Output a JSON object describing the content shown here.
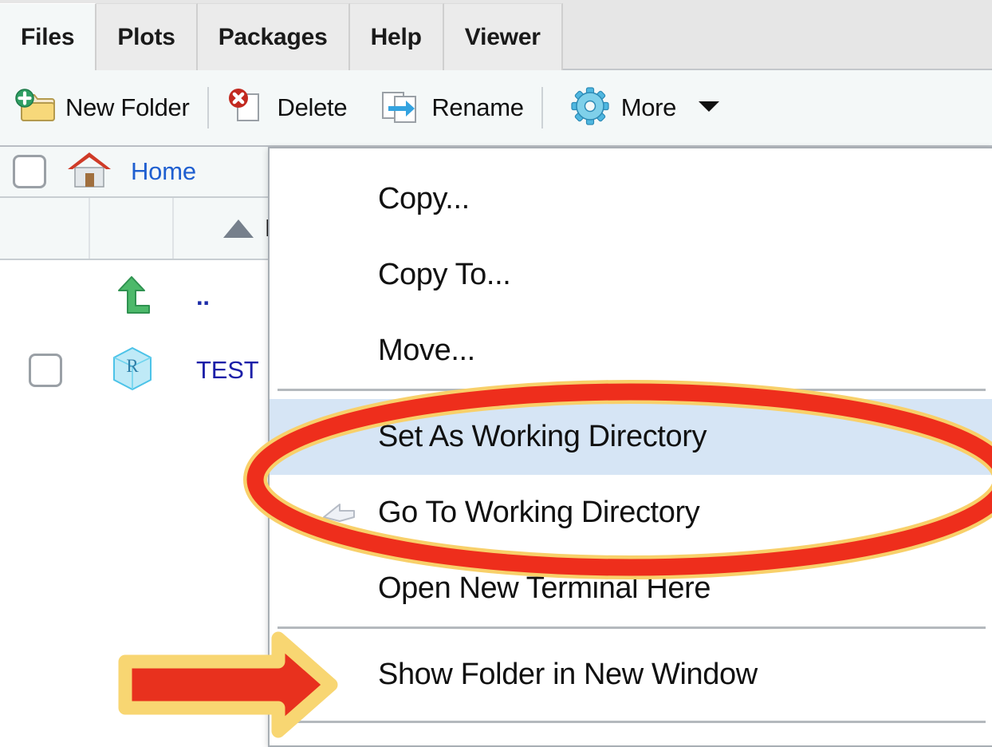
{
  "window": {
    "app": "RStudio Files pane"
  },
  "tabs": [
    {
      "label": "Files",
      "active": true
    },
    {
      "label": "Plots",
      "active": false
    },
    {
      "label": "Packages",
      "active": false
    },
    {
      "label": "Help",
      "active": false
    },
    {
      "label": "Viewer",
      "active": false
    }
  ],
  "toolbar": {
    "buttons": [
      {
        "label": "New Folder",
        "icon": "new-folder-icon"
      },
      {
        "label": "Delete",
        "icon": "delete-icon"
      },
      {
        "label": "Rename",
        "icon": "rename-icon"
      },
      {
        "label": "More",
        "icon": "gear-icon",
        "caret": true
      }
    ]
  },
  "path_bar": {
    "home_icon": "home-icon",
    "crumb": "Home"
  },
  "file_table": {
    "columns": [
      "",
      "",
      "Name"
    ],
    "sort_column": "Name",
    "sort_direction": "ascending",
    "rows": [
      {
        "name": "..",
        "icon": "up-arrow-icon",
        "checkbox": false
      },
      {
        "name": "TEST",
        "icon": "r-project-icon",
        "checkbox": true
      }
    ]
  },
  "context_menu": {
    "items": [
      {
        "label": "Copy...",
        "icon": null,
        "selected": false,
        "separator_after": false
      },
      {
        "label": "Copy To...",
        "icon": null,
        "selected": false,
        "separator_after": false
      },
      {
        "label": "Move...",
        "icon": null,
        "selected": false,
        "separator_after": true
      },
      {
        "label": "Set As Working Directory",
        "icon": null,
        "selected": true,
        "separator_after": false
      },
      {
        "label": "Go To Working Directory",
        "icon": "go-to-icon",
        "selected": false,
        "separator_after": false
      },
      {
        "label": "Open New Terminal Here",
        "icon": null,
        "selected": false,
        "separator_after": true
      },
      {
        "label": "Show Folder in New Window",
        "icon": null,
        "selected": false,
        "separator_after": true
      }
    ]
  },
  "annotations": {
    "ellipse": {
      "shape": "ellipse-highlight",
      "fill_color": "#EE2E1C",
      "outline_color": "#F8D06A",
      "targets": [
        "Set As Working Directory",
        "Go To Working Directory"
      ]
    },
    "arrow": {
      "shape": "arrow-right",
      "fill_color": "#E8311E",
      "outline_color": "#F8D672",
      "target": "Show Folder in New Window"
    }
  },
  "colors": {
    "tab_active_bg": "#F4F8F8",
    "tab_inactive_bg": "#EBEBEB",
    "toolbar_bg": "#F4F8F8",
    "menu_bg": "#FFFFFF",
    "menu_selection_bg": "#D6E5F5",
    "link_blue": "#1F5FD0",
    "file_blue": "#1C1FA8",
    "annotation_red": "#E8311E",
    "annotation_gold": "#F8D672"
  }
}
